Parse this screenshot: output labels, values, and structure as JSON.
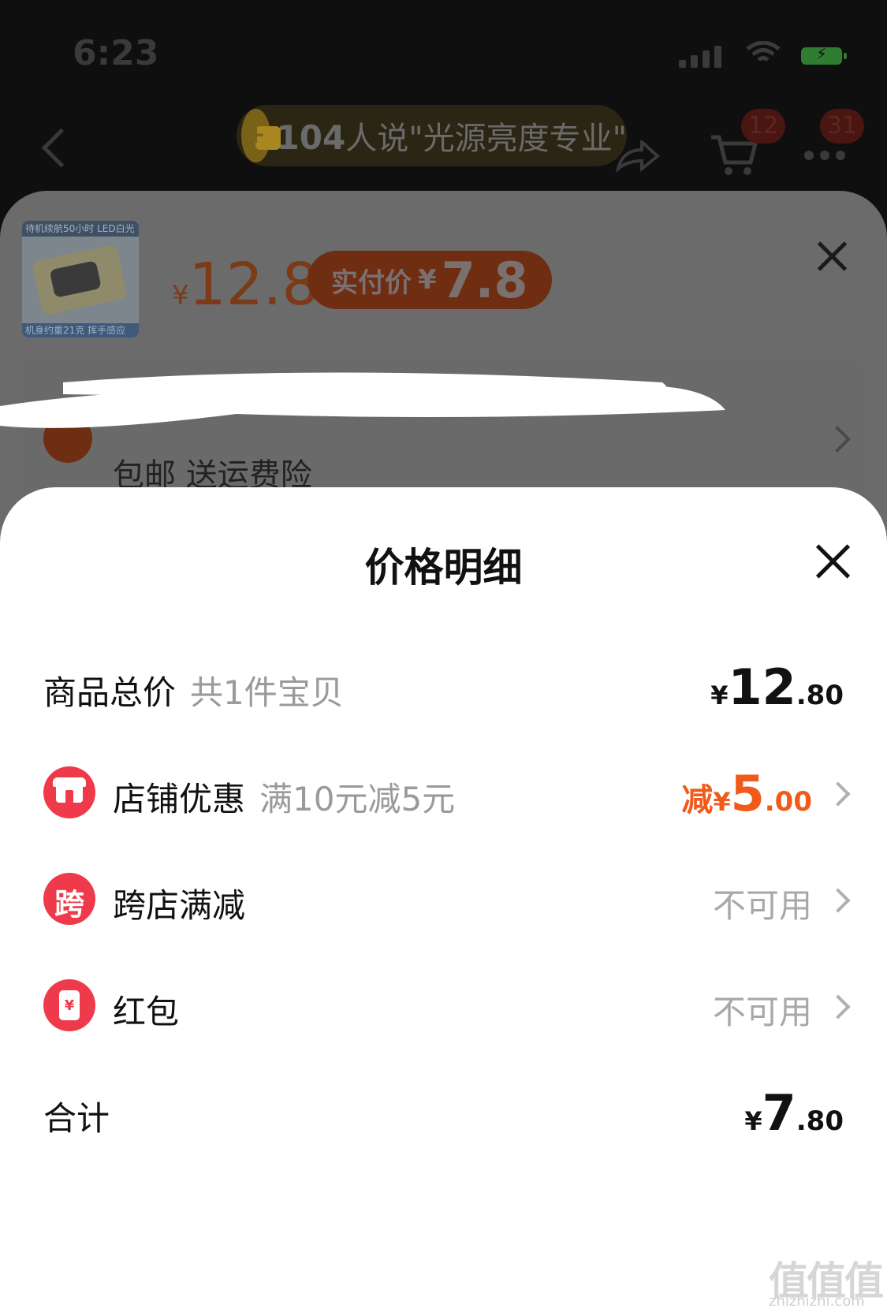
{
  "status_bar": {
    "time": "6:23"
  },
  "top_nav": {
    "banner_count": "104",
    "banner_text": "人说\"光源亮度专业\"",
    "cart_badge": "12",
    "more_badge": "31"
  },
  "product": {
    "thumb_top_text": "待机续航50小时  LED白光",
    "thumb_bottom_text": "机身约重21克  挥手感应",
    "currency": "¥",
    "price": "12.8",
    "actual_pay_label": "实付价",
    "actual_pay_currency": "¥",
    "actual_pay_value": "7.8",
    "shipping_text": "包邮  送运费险"
  },
  "price_detail": {
    "title": "价格明细",
    "rows": [
      {
        "label": "商品总价",
        "sub": "共1件宝贝",
        "currency": "¥",
        "int": "12",
        "dec": ".80"
      },
      {
        "label": "店铺优惠",
        "sub": "满10元减5元",
        "prefix": "减",
        "currency": "¥",
        "int": "5",
        "dec": ".00",
        "icon": "store-icon"
      },
      {
        "label": "跨店满减",
        "icon_text": "跨",
        "status": "不可用",
        "icon": "cross-store-icon"
      },
      {
        "label": "红包",
        "icon_text": "¥",
        "status": "不可用",
        "icon": "red-packet-icon"
      },
      {
        "label": "合计",
        "currency": "¥",
        "int": "7",
        "dec": ".80"
      }
    ]
  },
  "watermark": {
    "text": "值值值",
    "url": "zhizhizhi.com"
  },
  "colors": {
    "accent_red": "#ee3a4a",
    "discount_orange": "#f05a1a",
    "sheet_bg": "#ffffff"
  }
}
